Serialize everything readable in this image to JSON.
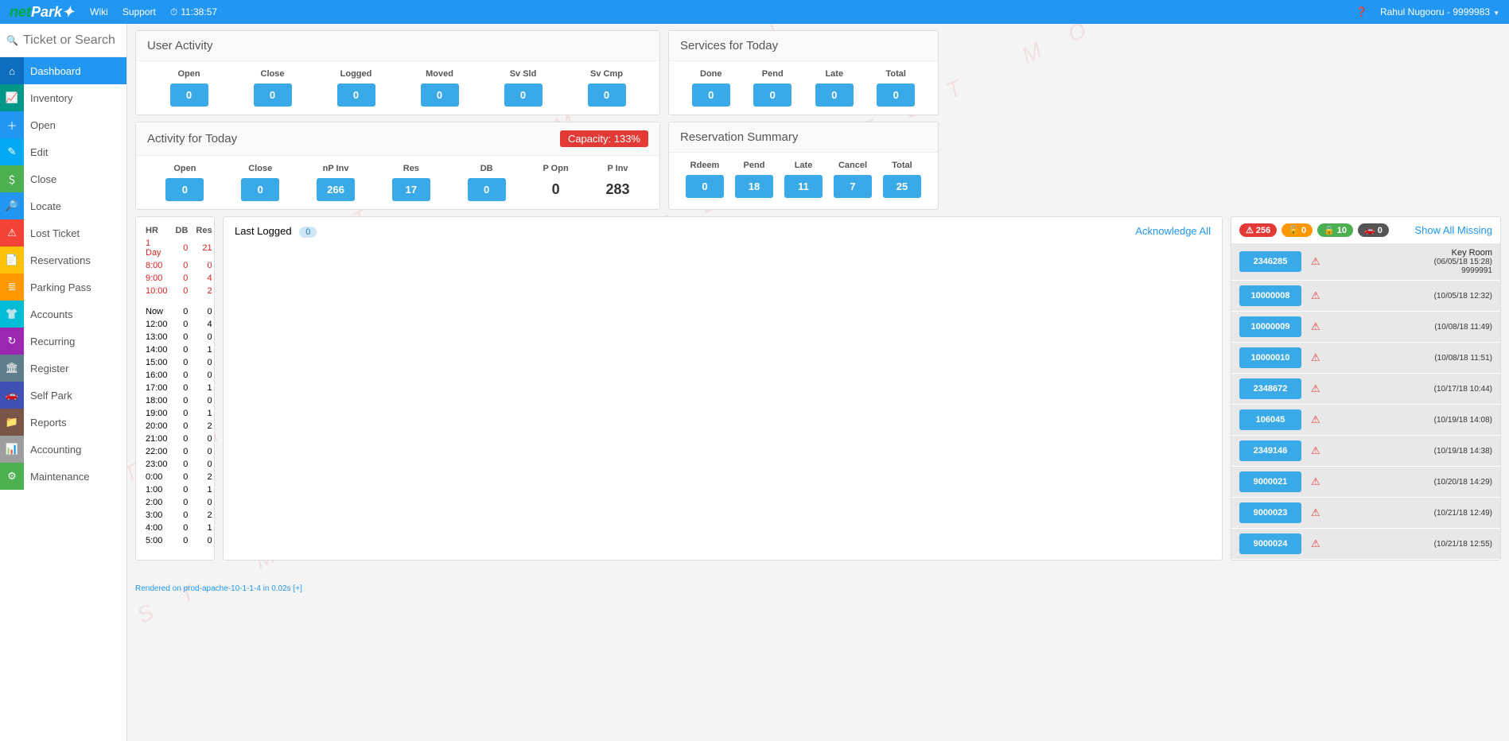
{
  "topbar": {
    "links": {
      "wiki": "Wiki",
      "support": "Support"
    },
    "clock": "11:38:57",
    "user": "Rahul Nugooru - 9999983"
  },
  "search": {
    "placeholder": "Ticket or Search"
  },
  "sidebar": [
    {
      "label": "Dashboard",
      "color": "#0d6dbf",
      "icon": "⌂",
      "active": true
    },
    {
      "label": "Inventory",
      "color": "#009688",
      "icon": "📈"
    },
    {
      "label": "Open",
      "color": "#2196f3",
      "icon": "＋"
    },
    {
      "label": "Edit",
      "color": "#03a9f4",
      "icon": "✎"
    },
    {
      "label": "Close",
      "color": "#4caf50",
      "icon": "＄"
    },
    {
      "label": "Locate",
      "color": "#2196f3",
      "icon": "🔎"
    },
    {
      "label": "Lost Ticket",
      "color": "#f44336",
      "icon": "⚠"
    },
    {
      "label": "Reservations",
      "color": "#ffc107",
      "icon": "📄"
    },
    {
      "label": "Parking Pass",
      "color": "#ff9800",
      "icon": "≣"
    },
    {
      "label": "Accounts",
      "color": "#00bcd4",
      "icon": "👕"
    },
    {
      "label": "Recurring",
      "color": "#9c27b0",
      "icon": "↻"
    },
    {
      "label": "Register",
      "color": "#607d8b",
      "icon": "🏛"
    },
    {
      "label": "Self Park",
      "color": "#3f51b5",
      "icon": "🚗"
    },
    {
      "label": "Reports",
      "color": "#795548",
      "icon": "📁"
    },
    {
      "label": "Accounting",
      "color": "#9e9e9e",
      "icon": "📊"
    },
    {
      "label": "Maintenance",
      "color": "#4caf50",
      "icon": "⚙"
    }
  ],
  "userActivity": {
    "title": "User Activity",
    "stats": [
      {
        "h": "Open",
        "v": "0"
      },
      {
        "h": "Close",
        "v": "0"
      },
      {
        "h": "Logged",
        "v": "0"
      },
      {
        "h": "Moved",
        "v": "0"
      },
      {
        "h": "Sv Sld",
        "v": "0"
      },
      {
        "h": "Sv Cmp",
        "v": "0"
      }
    ]
  },
  "servicesToday": {
    "title": "Services for Today",
    "stats": [
      {
        "h": "Done",
        "v": "0"
      },
      {
        "h": "Pend",
        "v": "0"
      },
      {
        "h": "Late",
        "v": "0"
      },
      {
        "h": "Total",
        "v": "0"
      }
    ]
  },
  "activityToday": {
    "title": "Activity for Today",
    "capacity": "Capacity: 133%",
    "stats": [
      {
        "h": "Open",
        "v": "0",
        "pill": true
      },
      {
        "h": "Close",
        "v": "0",
        "pill": true
      },
      {
        "h": "nP Inv",
        "v": "266",
        "pill": true
      },
      {
        "h": "Res",
        "v": "17",
        "pill": true
      },
      {
        "h": "DB",
        "v": "0",
        "pill": true
      },
      {
        "h": "P Opn",
        "v": "0",
        "pill": false
      },
      {
        "h": "P Inv",
        "v": "283",
        "pill": false
      }
    ]
  },
  "reservationSummary": {
    "title": "Reservation Summary",
    "stats": [
      {
        "h": "Rdeem",
        "v": "0"
      },
      {
        "h": "Pend",
        "v": "18"
      },
      {
        "h": "Late",
        "v": "11"
      },
      {
        "h": "Cancel",
        "v": "7"
      },
      {
        "h": "Total",
        "v": "25"
      }
    ]
  },
  "hrTable": {
    "headers": [
      "HR",
      "DB",
      "Res"
    ],
    "red": [
      [
        "1 Day",
        "0",
        "21"
      ],
      [
        "8:00",
        "0",
        "0"
      ],
      [
        "9:00",
        "0",
        "4"
      ],
      [
        "10:00",
        "0",
        "2"
      ]
    ],
    "rows": [
      [
        "Now",
        "0",
        "0"
      ],
      [
        "12:00",
        "0",
        "4"
      ],
      [
        "13:00",
        "0",
        "0"
      ],
      [
        "14:00",
        "0",
        "1"
      ],
      [
        "15:00",
        "0",
        "0"
      ],
      [
        "16:00",
        "0",
        "0"
      ],
      [
        "17:00",
        "0",
        "1"
      ],
      [
        "18:00",
        "0",
        "0"
      ],
      [
        "19:00",
        "0",
        "1"
      ],
      [
        "20:00",
        "0",
        "2"
      ],
      [
        "21:00",
        "0",
        "0"
      ],
      [
        "22:00",
        "0",
        "0"
      ],
      [
        "23:00",
        "0",
        "0"
      ],
      [
        "0:00",
        "0",
        "2"
      ],
      [
        "1:00",
        "0",
        "1"
      ],
      [
        "2:00",
        "0",
        "0"
      ],
      [
        "3:00",
        "0",
        "2"
      ],
      [
        "4:00",
        "0",
        "1"
      ],
      [
        "5:00",
        "0",
        "0"
      ]
    ]
  },
  "lastLogged": {
    "title": "Last Logged",
    "count": "0",
    "ack": "Acknowledge All"
  },
  "missing": {
    "link": "Show All Missing",
    "badges": {
      "alert": "256",
      "unlocked": "0",
      "locked": "10",
      "car": "0"
    },
    "rows": [
      {
        "t": "2346285",
        "meta": "Key Room",
        "sub": "(06/05/18 15:28)",
        "extra": "9999991"
      },
      {
        "t": "10000008",
        "sub": "(10/05/18 12:32)"
      },
      {
        "t": "10000009",
        "sub": "(10/08/18 11:49)"
      },
      {
        "t": "10000010",
        "sub": "(10/08/18 11:51)"
      },
      {
        "t": "2348672",
        "sub": "(10/17/18 10:44)"
      },
      {
        "t": "106045",
        "sub": "(10/19/18 14:08)"
      },
      {
        "t": "2349146",
        "sub": "(10/19/18 14:38)"
      },
      {
        "t": "9000021",
        "sub": "(10/20/18 14:29)"
      },
      {
        "t": "9000023",
        "sub": "(10/21/18 12:49)"
      },
      {
        "t": "9000024",
        "sub": "(10/21/18 12:55)"
      }
    ]
  },
  "footer": "Rendered on prod-apache-10-1-1-4 in 0.02s [+]"
}
